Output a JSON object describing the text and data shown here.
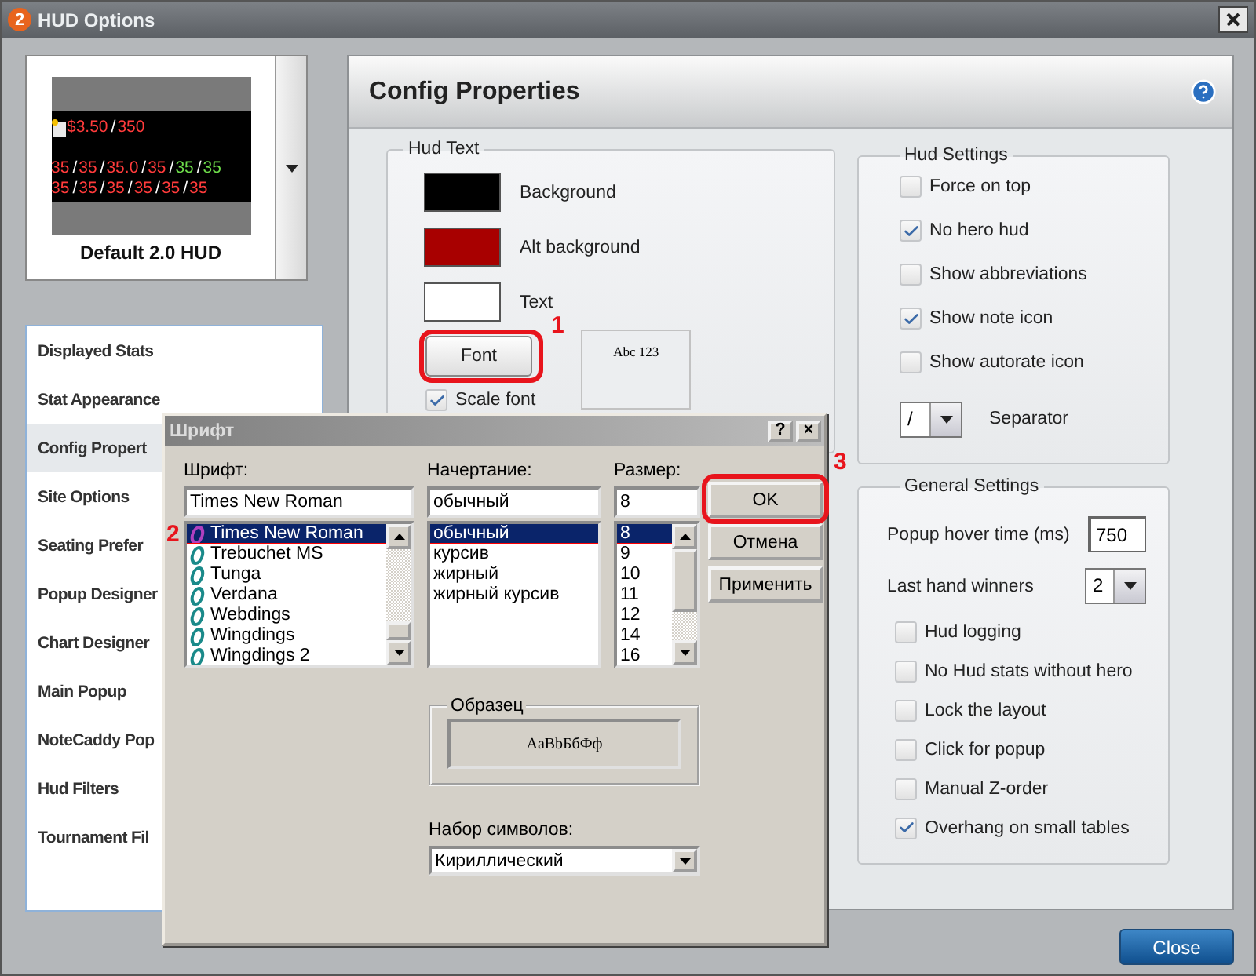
{
  "window": {
    "title": "HUD Options",
    "badge": "2"
  },
  "hud_preview": {
    "name": "Default 2.0 HUD",
    "separator": "/",
    "rows": [
      [
        {
          "value": "$3.50",
          "color": "#ff3b3b"
        },
        {
          "value": "350",
          "color": "#ff3b3b"
        }
      ],
      [
        {
          "value": "35",
          "color": "#ff3b3b"
        },
        {
          "value": "35",
          "color": "#ff3b3b"
        },
        {
          "value": "35.0",
          "color": "#ff3b3b"
        },
        {
          "value": "35",
          "color": "#ff3b3b"
        },
        {
          "value": "35",
          "color": "#6ddc4a"
        },
        {
          "value": "35",
          "color": "#6ddc4a"
        }
      ],
      [
        {
          "value": "35",
          "color": "#ff3b3b"
        },
        {
          "value": "35",
          "color": "#ff3b3b"
        },
        {
          "value": "35",
          "color": "#ff3b3b"
        },
        {
          "value": "35",
          "color": "#ff3b3b"
        },
        {
          "value": "35",
          "color": "#ff3b3b"
        },
        {
          "value": "35",
          "color": "#ff3b3b"
        }
      ]
    ]
  },
  "nav": [
    {
      "label": "Displayed Stats",
      "selected": false
    },
    {
      "label": "Stat Appearance",
      "selected": false
    },
    {
      "label": "Config Propert",
      "selected": true
    },
    {
      "label": "Site Options",
      "selected": false
    },
    {
      "label": "Seating Prefer",
      "selected": false
    },
    {
      "label": "Popup Designer",
      "selected": false
    },
    {
      "label": "Chart Designer",
      "selected": false
    },
    {
      "label": "Main Popup",
      "selected": false
    },
    {
      "label": "NoteCaddy Pop",
      "selected": false
    },
    {
      "label": "Hud Filters",
      "selected": false
    },
    {
      "label": "Tournament Fil",
      "selected": false
    }
  ],
  "panel": {
    "title": "Config Properties"
  },
  "hud_text": {
    "title": "Hud Text",
    "swatches": [
      {
        "label": "Background",
        "color": "#000000"
      },
      {
        "label": "Alt background",
        "color": "#a80000"
      },
      {
        "label": "Text",
        "color": "#ffffff"
      }
    ],
    "font_button": {
      "label": "Font",
      "annotation": "1"
    },
    "font_sample": "Abc 123",
    "scale_font": {
      "label": "Scale font",
      "checked": true
    }
  },
  "hud_settings": {
    "title": "Hud Settings",
    "options": [
      {
        "label": "Force on top",
        "checked": false
      },
      {
        "label": "No hero hud",
        "checked": true
      },
      {
        "label": "Show abbreviations",
        "checked": false
      },
      {
        "label": "Show note icon",
        "checked": true
      },
      {
        "label": "Show autorate icon",
        "checked": false
      }
    ],
    "separator": {
      "value": "/",
      "label": "Separator"
    }
  },
  "general_settings": {
    "title": "General Settings",
    "hover_time": {
      "label": "Popup hover time (ms)",
      "value": "750"
    },
    "last_hand_winners": {
      "label": "Last hand winners",
      "value": "2"
    },
    "options": [
      {
        "label": "Hud logging",
        "checked": false
      },
      {
        "label": "No Hud stats without hero",
        "checked": false
      },
      {
        "label": "Lock the layout",
        "checked": false
      },
      {
        "label": "Click for popup",
        "checked": false
      },
      {
        "label": "Manual Z-order",
        "checked": false
      },
      {
        "label": "Overhang on small tables",
        "checked": true
      }
    ]
  },
  "close_button": "Close",
  "font_dialog": {
    "title": "Шрифт",
    "help": "?",
    "close": "×",
    "font": {
      "label": "Шрифт:",
      "value": "Times New Roman",
      "annotation": "2",
      "underlined": true,
      "items": [
        {
          "label": "Times New Roman",
          "selected": true
        },
        {
          "label": "Trebuchet MS",
          "selected": false
        },
        {
          "label": "Tunga",
          "selected": false
        },
        {
          "label": "Verdana",
          "selected": false
        },
        {
          "label": "Webdings",
          "selected": false
        },
        {
          "label": "Wingdings",
          "selected": false
        },
        {
          "label": "Wingdings 2",
          "selected": false
        }
      ]
    },
    "style": {
      "label": "Начертание:",
      "value": "обычный",
      "underlined": true,
      "items": [
        {
          "label": "обычный",
          "selected": true
        },
        {
          "label": "курсив",
          "selected": false
        },
        {
          "label": "жирный",
          "selected": false
        },
        {
          "label": "жирный курсив",
          "selected": false
        }
      ]
    },
    "size": {
      "label": "Размер:",
      "value": "8",
      "underlined": true,
      "items": [
        {
          "label": "8",
          "selected": true
        },
        {
          "label": "9",
          "selected": false
        },
        {
          "label": "10",
          "selected": false
        },
        {
          "label": "11",
          "selected": false
        },
        {
          "label": "12",
          "selected": false
        },
        {
          "label": "14",
          "selected": false
        },
        {
          "label": "16",
          "selected": false
        }
      ]
    },
    "buttons": [
      {
        "label": "OK",
        "annotation": "3"
      },
      {
        "label": "Отмена"
      },
      {
        "label": "Применить"
      }
    ],
    "sample": {
      "title": "Образец",
      "text": "AaBbБбФф"
    },
    "script": {
      "label": "Набор символов:",
      "value": "Кириллический"
    }
  }
}
